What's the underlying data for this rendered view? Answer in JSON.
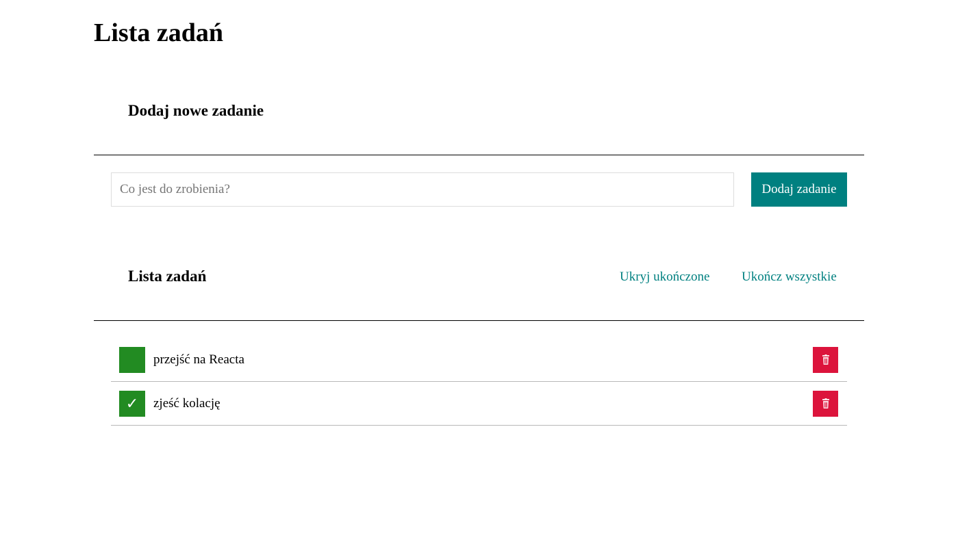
{
  "app": {
    "title": "Lista zadań"
  },
  "new_task": {
    "heading": "Dodaj nowe zadanie",
    "input_value": "",
    "input_placeholder": "Co jest do zrobienia?",
    "add_button_label": "Dodaj zadanie"
  },
  "task_list": {
    "heading": "Lista zadań",
    "hide_completed_label": "Ukryj ukończone",
    "complete_all_label": "Ukończ wszystkie",
    "items": [
      {
        "text": "przejść na Reacta",
        "completed": false,
        "check_glyph": ""
      },
      {
        "text": "zjeść kolację",
        "completed": true,
        "check_glyph": "✓"
      }
    ]
  },
  "icons": {
    "check": "checkmark-icon",
    "delete": "trash-icon"
  },
  "colors": {
    "accent": "#008080",
    "checkbox": "#228b22",
    "delete": "#dc143c"
  }
}
